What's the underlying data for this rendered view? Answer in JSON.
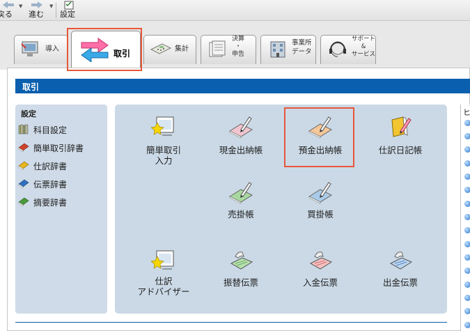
{
  "toolbar": {
    "back_label": "戻る",
    "forward_label": "進む",
    "settings_label": "設定"
  },
  "tabs": [
    {
      "id": "intro",
      "label": "導入",
      "icon": "computer-icon"
    },
    {
      "id": "torihiki",
      "label": "取引",
      "icon": "exchange-arrows-icon"
    },
    {
      "id": "shukei",
      "label": "集計",
      "icon": "calculator-icon"
    },
    {
      "id": "kessan",
      "label_lines": [
        "決算",
        "・",
        "申告"
      ],
      "icon": "document-stack-icon"
    },
    {
      "id": "jigyosho",
      "label_lines": [
        "事業所",
        "データ"
      ],
      "icon": "building-icon"
    },
    {
      "id": "support",
      "label_lines": [
        "サポート",
        "&",
        "サービス"
      ],
      "icon": "headset-icon"
    }
  ],
  "section_title": "取引",
  "settings": {
    "heading": "設定",
    "items": [
      {
        "label": "科目設定",
        "icon": "books-icon",
        "color": "#8a9a6a"
      },
      {
        "label": "簡単取引辞書",
        "icon": "red-book-icon",
        "color": "#d0442c"
      },
      {
        "label": "仕訳辞書",
        "icon": "yellow-book-icon",
        "color": "#e7b51f"
      },
      {
        "label": "伝票辞書",
        "icon": "blue-book-icon",
        "color": "#2f6fbf"
      },
      {
        "label": "摘要辞書",
        "icon": "green-book-icon",
        "color": "#4a9a3c"
      }
    ]
  },
  "tiles": [
    {
      "label_lines": [
        "簡単取引",
        "入力"
      ],
      "icon": "wizard-screen-icon"
    },
    {
      "label_lines": [
        "現金出納帳"
      ],
      "icon": "pink-ledger-pen-icon"
    },
    {
      "label_lines": [
        "預金出納帳"
      ],
      "icon": "orange-ledger-pen-icon"
    },
    {
      "label_lines": [
        "仕訳日記帳"
      ],
      "icon": "yellow-journal-pen-icon"
    },
    {
      "label_lines": [
        "売掛帳"
      ],
      "icon": "green-ledger-pen-icon"
    },
    {
      "label_lines": [
        "買掛帳"
      ],
      "icon": "blue-ledger-pen-icon"
    },
    {
      "label_lines": [
        "仕訳",
        "アドバイザー"
      ],
      "icon": "advisor-screen-icon"
    },
    {
      "label_lines": [
        "振替伝票"
      ],
      "icon": "green-slip-icon"
    },
    {
      "label_lines": [
        "入金伝票"
      ],
      "icon": "red-slip-icon"
    },
    {
      "label_lines": [
        "出金伝票"
      ],
      "icon": "blue-slip-icon"
    }
  ],
  "right_panel": {
    "heading": "ヒ"
  },
  "colors": {
    "accent_blue": "#0a5fae",
    "highlight": "#e8563a",
    "panel_bg": "#cbd9e6"
  }
}
